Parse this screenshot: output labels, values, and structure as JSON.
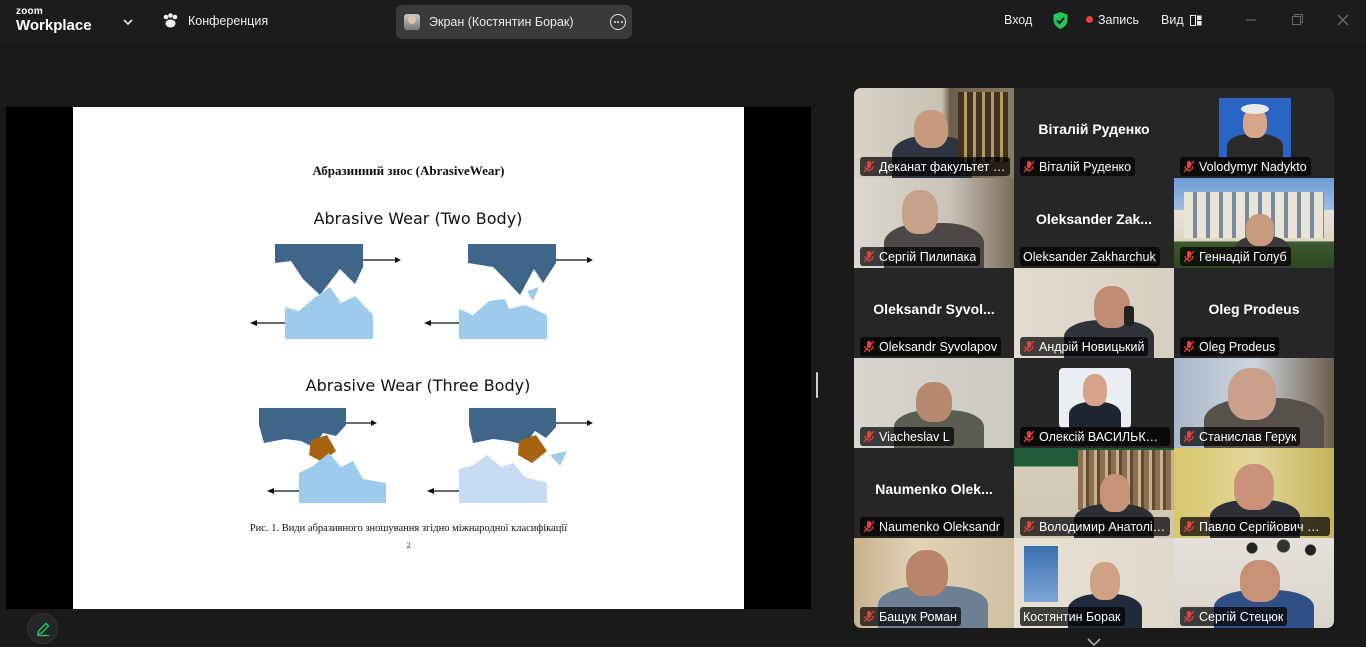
{
  "titlebar": {
    "brand_small": "zoom",
    "brand_large": "Workplace",
    "meeting_label": "Конференция",
    "screen_share_label": "Экран (Костянтин Борак)",
    "signin_label": "Вход",
    "record_label": "Запись",
    "view_label": "Вид"
  },
  "slide": {
    "heading": "Абразинний знос (AbrasiveWear)",
    "diagram_two_body_title": "Abrasive Wear (Two Body)",
    "diagram_three_body_title": "Abrasive Wear (Three Body)",
    "caption": "Рис. 1. Види абразивного зношування згідно міжнародної класифікації",
    "page_number": "2"
  },
  "colors": {
    "upper_body": "#3f6688",
    "lower_body": "#9ccbec",
    "lower_body_light": "#c5dcf3",
    "particle": "#a86210",
    "active_speaker": "#22c55e",
    "record_dot": "#e5413b",
    "security_shield": "#22c55e"
  },
  "participants": [
    {
      "name": "Деканат факультет к...",
      "type": "video",
      "muted": true
    },
    {
      "name": "Віталій Руденко",
      "type": "name_only",
      "display_name": "Віталій Руденко",
      "muted": true
    },
    {
      "name": "Volodymyr Nadykto",
      "type": "avatar",
      "muted": true
    },
    {
      "name": "Сергій Пилипака",
      "type": "video",
      "muted": true
    },
    {
      "name": "Oleksander Zakharchuk",
      "type": "name_only",
      "display_name": "Oleksander  Zak...",
      "muted": false
    },
    {
      "name": "Геннадій Голуб",
      "type": "video",
      "muted": true
    },
    {
      "name": "Oleksandr Syvolapov",
      "type": "name_only",
      "display_name": "Oleksandr  Syvol...",
      "muted": true
    },
    {
      "name": "Андрій Новицький",
      "type": "video",
      "muted": true
    },
    {
      "name": "Oleg Prodeus",
      "type": "name_only",
      "display_name": "Oleg Prodeus",
      "muted": true
    },
    {
      "name": "Viacheslav L",
      "type": "video",
      "muted": true
    },
    {
      "name": "Олексій ВАСИЛЬКОВ...",
      "type": "avatar",
      "muted": true
    },
    {
      "name": "Станислав Герук",
      "type": "video",
      "muted": true
    },
    {
      "name": "Naumenko Oleksandr",
      "type": "name_only",
      "display_name": "Naumenko  Olek...",
      "muted": true
    },
    {
      "name": "Володимир Анатолій...",
      "type": "video",
      "muted": true
    },
    {
      "name": "Павло Сергійович П...",
      "type": "video",
      "muted": true
    },
    {
      "name": "Бащук Роман",
      "type": "video",
      "muted": true
    },
    {
      "name": "Костянтин Борак",
      "type": "video",
      "muted": false,
      "active": true
    },
    {
      "name": "Сергій Стецюк",
      "type": "video",
      "muted": true
    }
  ],
  "icons": {
    "meeting": "paw-icon",
    "security": "shield-check-icon",
    "view": "grid-view-icon",
    "mic_muted": "mic-muted-icon",
    "edit": "pencil-icon"
  }
}
